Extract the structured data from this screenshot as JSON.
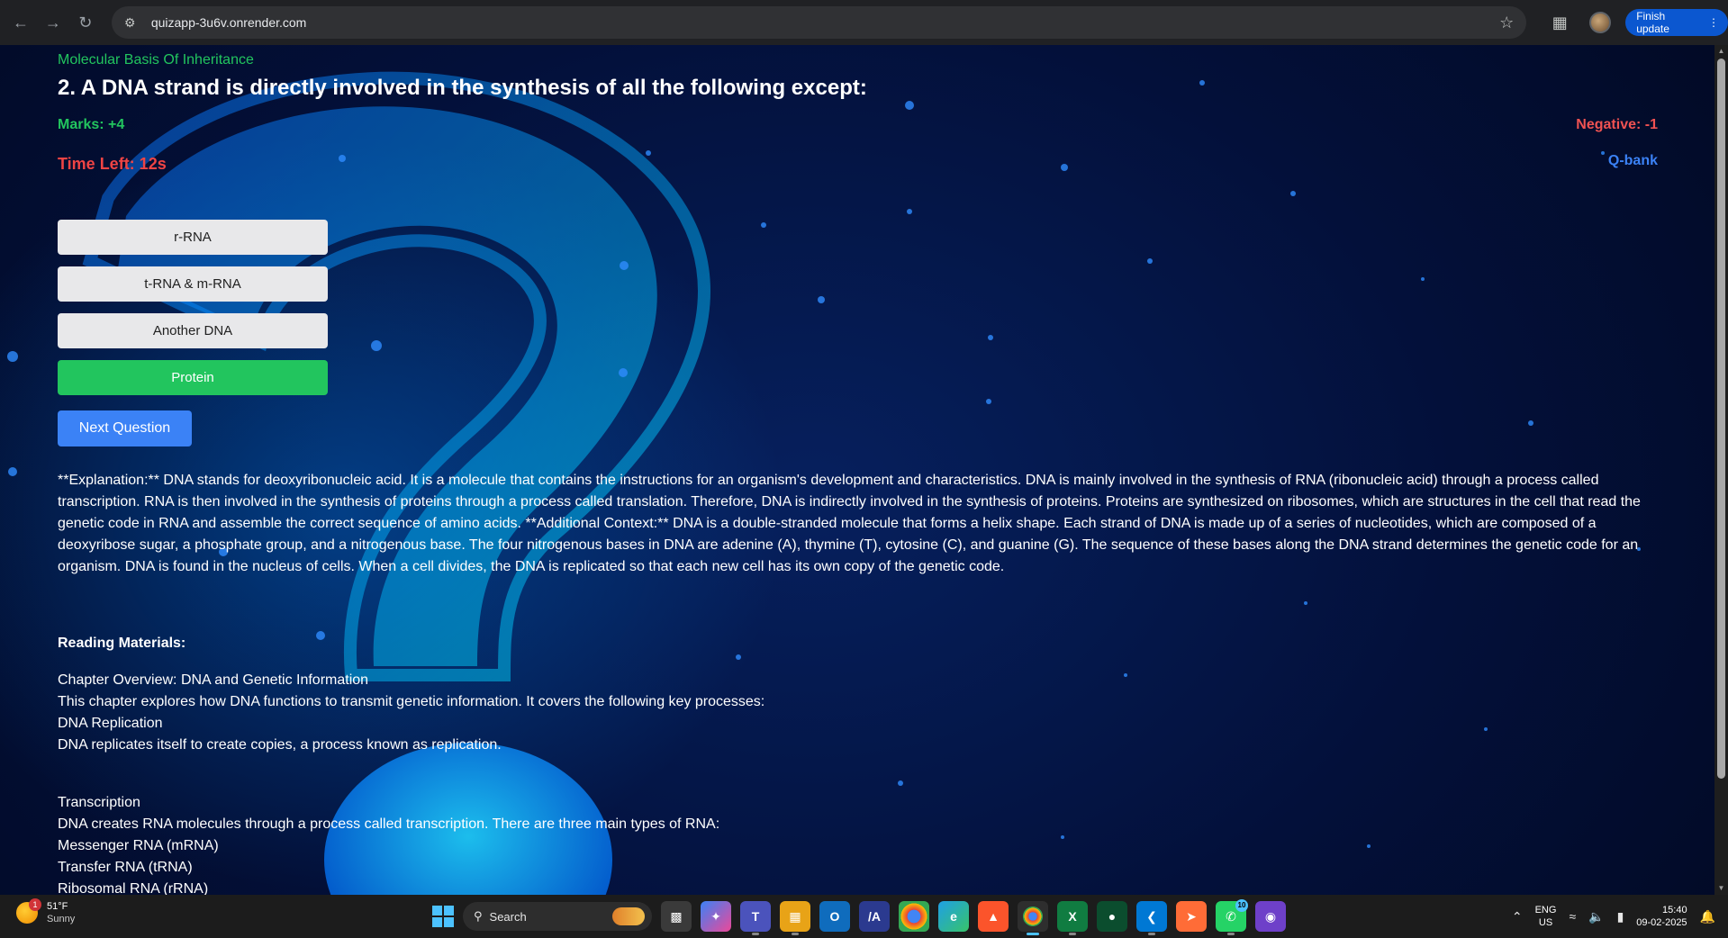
{
  "browser": {
    "url": "quizapp-3u6v.onrender.com",
    "finish_update": "Finish update"
  },
  "quiz": {
    "subject": "Molecular Basis Of Inheritance",
    "question": "2. A DNA strand is directly involved in the synthesis of all the following except:",
    "marks": "Marks: +4",
    "negative": "Negative: -1",
    "time_left": "Time Left: 12s",
    "qbank": "Q-bank",
    "options": [
      "r-RNA",
      "t-RNA & m-RNA",
      "Another DNA",
      "Protein"
    ],
    "correct_option": "Protein",
    "next_label": "Next Question",
    "explanation": "**Explanation:** DNA stands for deoxyribonucleic acid. It is a molecule that contains the instructions for an organism's development and characteristics. DNA is mainly involved in the synthesis of RNA (ribonucleic acid) through a process called transcription. RNA is then involved in the synthesis of proteins through a process called translation. Therefore, DNA is indirectly involved in the synthesis of proteins. Proteins are synthesized on ribosomes, which are structures in the cell that read the genetic code in RNA and assemble the correct sequence of amino acids. **Additional Context:** DNA is a double-stranded molecule that forms a helix shape. Each strand of DNA is made up of a series of nucleotides, which are composed of a deoxyribose sugar, a phosphate group, and a nitrogenous base. The four nitrogenous bases in DNA are adenine (A), thymine (T), cytosine (C), and guanine (G). The sequence of these bases along the DNA strand determines the genetic code for an organism. DNA is found in the nucleus of cells. When a cell divides, the DNA is replicated so that each new cell has its own copy of the genetic code.",
    "reading_title": "Reading Materials:",
    "reading_lines_1": [
      "Chapter Overview: DNA and Genetic Information",
      "This chapter explores how DNA functions to transmit genetic information. It covers the following key processes:",
      "DNA Replication",
      "DNA replicates itself to create copies, a process known as replication."
    ],
    "reading_lines_2": [
      "Transcription",
      "DNA creates RNA molecules through a process called transcription. There are three main types of RNA:",
      "Messenger RNA (mRNA)",
      "Transfer RNA (tRNA)",
      "Ribosomal RNA (rRNA)"
    ]
  },
  "taskbar": {
    "weather_temp": "51°F",
    "weather_cond": "Sunny",
    "weather_badge": "1",
    "search_label": "Search",
    "lang_1": "ENG",
    "lang_2": "US",
    "time": "15:40",
    "date": "09-02-2025",
    "whatsapp_badge": "10"
  },
  "colors": {
    "marks_green": "#22c55e",
    "negative_red": "#f05252",
    "timer_red": "#ef4444",
    "qbank_blue": "#3b82f6",
    "correct_green": "#22c55e"
  }
}
